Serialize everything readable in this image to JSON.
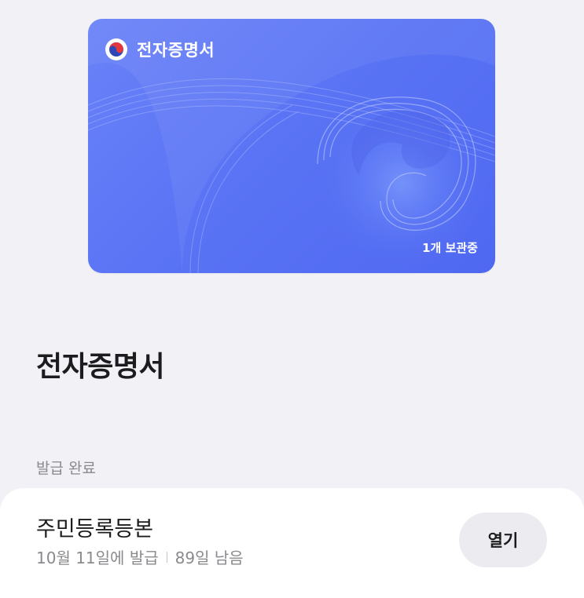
{
  "card": {
    "title": "전자증명서",
    "count_label": "1개 보관중",
    "emblem_icon": "taegeuk-emblem-icon",
    "colors": {
      "gradient_start": "#6a82f8",
      "gradient_end": "#4f68f1"
    }
  },
  "page": {
    "title": "전자증명서"
  },
  "section": {
    "label": "발급 완료"
  },
  "documents": [
    {
      "name": "주민등록등본",
      "issued": "10월 11일에 발급",
      "remaining": "89일 남음",
      "action_label": "열기"
    }
  ]
}
